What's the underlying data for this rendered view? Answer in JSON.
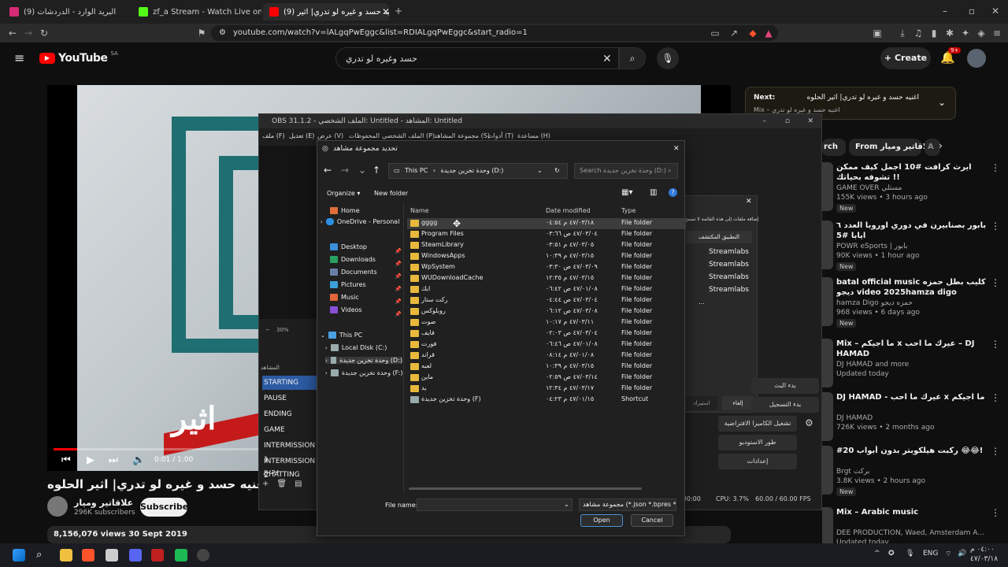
{
  "browser": {
    "tabs": [
      {
        "label": "(9) البريد الوارد - الدردشات"
      },
      {
        "label": "zf_a Stream - Watch Live on Kick"
      },
      {
        "label": "(9) اغنيه حسد و غيره لو تدري| اثير"
      }
    ],
    "url": "youtube.com/watch?v=lALgqPwEggc&list=RDIALgqPwEggc&start_radio=1"
  },
  "youtube": {
    "logo": "YouTube",
    "region": "SA",
    "search_value": "حسد وغيره لو تدري",
    "create_label": "Create",
    "notif_count": "9+",
    "player": {
      "time": "0:01 / 1:00",
      "overlay_text": "اثير"
    },
    "video_title": "اغنيه حسد و غيره لو تدري| اثير الحلوه",
    "channel_name": "علاقاتير وميار",
    "channel_subs": "296K subscribers",
    "subscribe_label": "Subscribe",
    "desc_stats": "8,156,076 views  30 Sept 2019",
    "next": {
      "label": "Next:",
      "title": "اغنيه حسد و غيره لو تدري| اثير الحلوه",
      "sub": "Mix – اغنيه حسد و غيره لو تدري"
    },
    "chips": [
      "rch",
      "From علاقاتير وميار",
      "A"
    ],
    "recs": [
      {
        "title": "ايرث كرافت #10 اجمل كيف ممكن تشوفه بحياتك !!",
        "channel": "GAME OVER مستلي",
        "meta": "155K views • 3 hours ago",
        "badge": "New"
      },
      {
        "title": "بابور بصنابيرن في دوري اوروبا العدد ٦ ايابا #5",
        "channel": "POWR eSports | بابور",
        "meta": "90K views • 1 hour ago",
        "badge": "New"
      },
      {
        "title": "batal official music كليب بطل حمزه ديجو video 2025hamza digo",
        "channel": "hamza Digo حمزه ديجو",
        "meta": "968 views • 6 days ago",
        "badge": "New"
      },
      {
        "title": "Mix – ما اجيكم x عيرك ما احب – DJ HAMAD",
        "channel": "DJ HAMAD and more",
        "meta": "Updated today",
        "badge": ""
      },
      {
        "title": "DJ HAMAD - عيرك ما احب x ما اجيكم",
        "channel": "DJ HAMAD",
        "meta": "726K views • 2 months ago",
        "badge": ""
      },
      {
        "title": "#20 ركبت هيلكوبتر بدون أبواب 😂😂!",
        "channel": "Brgt بركت",
        "meta": "3.8K views • 2 hours ago",
        "badge": "New"
      },
      {
        "title": "Mix – Arabic music",
        "channel": "DEE PRODUCTION, Waed, Amsterdam A...",
        "meta": "Updated today",
        "badge": ""
      }
    ]
  },
  "obs": {
    "title": "OBS 31.1.2 - الملف الشخصي: Untitled - المشاهد: Untitled",
    "menu": [
      "ملف (F)",
      "تعديل (E)",
      "عرض (V)",
      "المحفوظات",
      "الملف الشخصي (P)",
      "مجموعة المشاهد (S)",
      "أدوات (T)",
      "مساعدة (H)"
    ],
    "zoom": "30%",
    "scenes_header": "المشاهد",
    "scenes": [
      "STARTING",
      "PAUSE",
      "ENDING",
      "GAME",
      "INTERMISSION 1",
      "INTERMISSION 2",
      "JUST CHATTING"
    ],
    "panel_note": "إضافة ملفات إلى هذه القائمة لا تسمح",
    "panel_col": "التطبيق المكتشف",
    "streamlabs_rows": [
      "Streamlabs",
      "Streamlabs",
      "Streamlabs",
      "Streamlabs"
    ],
    "ellipsis": "...",
    "cancel_btn": "إلغاء",
    "import_btn": "استيراد",
    "controls": [
      "بدء البث",
      "بدء التسجيل",
      "تشغيل الكاميرا الافتراضية",
      "طور الاستوديو",
      "إعدادات"
    ],
    "status_time": "0:00:00",
    "cpu": "CPU: 3.7%",
    "fps": "60.00 / 60.00 FPS"
  },
  "dialog": {
    "title": "تحديد مجموعة مشاهد",
    "breadcrumb": [
      "This PC",
      "وحدة تخزين جديدة (D:)"
    ],
    "search_placeholder": "Search وحدة تخزين جديدة (D:)",
    "organize": "Organize",
    "new_folder": "New folder",
    "sidebar": {
      "home": "Home",
      "onedrive": "OneDrive - Personal",
      "desktop": "Desktop",
      "downloads": "Downloads",
      "documents": "Documents",
      "pictures": "Pictures",
      "music": "Music",
      "videos": "Videos",
      "this_pc": "This PC",
      "local_disk": "Local Disk (C:)",
      "drive_d": "وحدة تخزين جديدة (D:)",
      "drive_f": "وحدة تخزين جديدة (F:)"
    },
    "columns": {
      "name": "Name",
      "date": "Date modified",
      "type": "Type"
    },
    "files": [
      {
        "name": "gggg",
        "date": "٤٧/٠٣/١٨ م ٠٤:٥٤",
        "type": "File folder"
      },
      {
        "name": "Program Files",
        "date": "٤٧/٠٣/٠٤ ص ٠٣:٦٦",
        "type": "File folder"
      },
      {
        "name": "SteamLibrary",
        "date": "٤٧/٠٣/٠٥ م ٠٣:٥١",
        "type": "File folder"
      },
      {
        "name": "WindowsApps",
        "date": "٤٧/٠٣/١٥ م ١٠:٣٩",
        "type": "File folder"
      },
      {
        "name": "WpSystem",
        "date": "٤٧/٠٣/٠٩ ص ٠٣:٣٠",
        "type": "File folder"
      },
      {
        "name": "WUDownloadCache",
        "date": "٤٧/٠٣/١٥ م ١٢:٣٥",
        "type": "File folder"
      },
      {
        "name": "ابك",
        "date": "٤٧/٠١/٠٨ ص ٠٦:٤٢",
        "type": "File folder"
      },
      {
        "name": "ركت ستار",
        "date": "٤٧/٠٣/٠٤ ص ٠٤:٤٤",
        "type": "File folder"
      },
      {
        "name": "روبلوكس",
        "date": "٤٧/٠٣/٠٨ ص ٠٦:١٢",
        "type": "File folder"
      },
      {
        "name": "صوت",
        "date": "٤٧/٠٣/١١ م ١٠:١٧",
        "type": "File folder"
      },
      {
        "name": "فايف",
        "date": "٤٧/٠٣/٠٤ ص ٠٢:٠٣",
        "type": "File folder"
      },
      {
        "name": "فورت",
        "date": "٤٧/٠١/٠٨ ص ٠٦:٤٦",
        "type": "File folder"
      },
      {
        "name": "قراند",
        "date": "٤٧/٠١/٠٨ م ٠٨:١٤",
        "type": "File folder"
      },
      {
        "name": "لعبه",
        "date": "٤٧/٠٣/١٥ م ١٠:٣٩",
        "type": "File folder"
      },
      {
        "name": "ماين",
        "date": "٤٧/٠٣/١٤ ص ٠٢:٥٩",
        "type": "File folder"
      },
      {
        "name": "يد",
        "date": "٤٧/٠٣/١٧ م ١٢:٣٤",
        "type": "File folder"
      },
      {
        "name": "وحدة تخزين جديدة (F)",
        "date": "٤٧/٠١/١٥ م ٠٤:٢٣",
        "type": "Shortcut"
      }
    ],
    "filename_label": "File name:",
    "filename_value": "",
    "filter": "مجموعة مشاهد (*.json *.bpres *...",
    "open": "Open",
    "cancel": "Cancel"
  },
  "taskbar": {
    "lang": "ENG",
    "time": "٠٤:٠٠ م",
    "date": "٤٧/٠٣/١٨"
  }
}
